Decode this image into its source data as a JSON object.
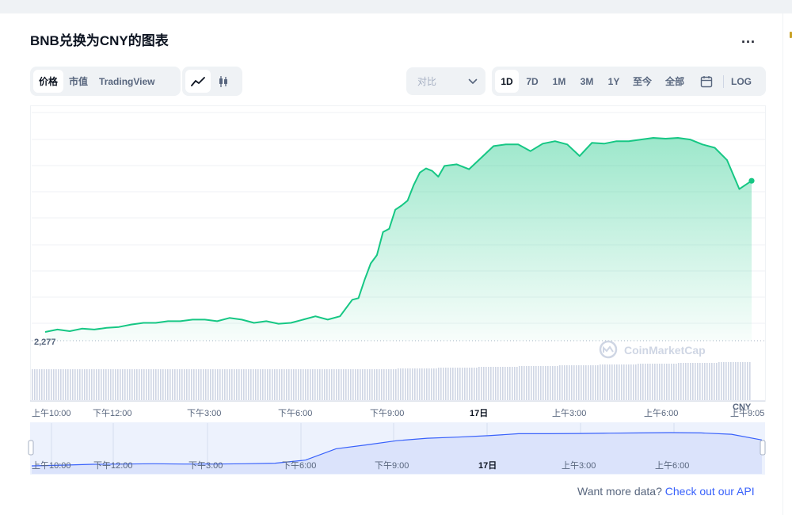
{
  "header": {
    "title": "BNB兑换为CNY的图表",
    "more_label": "..."
  },
  "toolbar": {
    "type_tabs": [
      "价格",
      "市值",
      "TradingView"
    ],
    "active_type": "价格",
    "view_icons": [
      "line-chart-icon",
      "candlestick-icon"
    ],
    "compare_placeholder": "对比",
    "ranges": [
      "1D",
      "7D",
      "1M",
      "3M",
      "1Y",
      "至今",
      "全部"
    ],
    "active_range": "1D",
    "calendar_icon": "calendar-icon",
    "log_label": "LOG"
  },
  "watermark": "CoinMarketCap",
  "footer": {
    "prefix": "Want more data?",
    "link": "Check out our API"
  },
  "colors": {
    "line": "#16c784",
    "accent": "#3861fb",
    "navigator_line": "#3861fb"
  },
  "chart_data": {
    "type": "line",
    "baseline_label": "2,277",
    "currency_label": "CNY",
    "x_tick_labels": [
      "上午10:00",
      "下午12:00",
      "下午3:00",
      "下午6:00",
      "下午9:00",
      "17日",
      "上午3:00",
      "上午6:00",
      "上午9:05"
    ],
    "navigator_tick_labels": [
      "上午10:00",
      "下午12:00",
      "下午3:00",
      "下午6:00",
      "下午9:00",
      "17日",
      "上午3:00",
      "上午6:00"
    ],
    "x_hours": [
      0,
      0.4,
      0.8,
      1.2,
      1.6,
      2.0,
      2.4,
      2.8,
      3.2,
      3.6,
      4.0,
      4.4,
      4.8,
      5.2,
      5.6,
      6.0,
      6.4,
      6.8,
      7.2,
      7.6,
      8.0,
      8.4,
      8.8,
      9.2,
      9.6,
      10.0,
      10.2,
      10.4,
      10.6,
      10.8,
      11.0,
      11.2,
      11.4,
      11.6,
      11.8,
      12.0,
      12.2,
      12.4,
      12.6,
      12.8,
      13.0,
      13.4,
      13.8,
      14.2,
      14.6,
      15.0,
      15.4,
      15.8,
      16.2,
      16.6,
      17.0,
      17.4,
      17.8,
      18.2,
      18.6,
      19.0,
      19.4,
      19.8,
      20.2,
      20.6,
      21.0,
      21.4,
      21.8,
      22.2,
      22.6,
      23.0
    ],
    "values": [
      2277,
      2280,
      2278,
      2281,
      2280,
      2282,
      2283,
      2286,
      2288,
      2288,
      2290,
      2290,
      2292,
      2292,
      2290,
      2294,
      2292,
      2288,
      2290,
      2287,
      2288,
      2292,
      2296,
      2292,
      2296,
      2316,
      2318,
      2340,
      2360,
      2370,
      2398,
      2402,
      2425,
      2430,
      2436,
      2455,
      2470,
      2475,
      2472,
      2465,
      2478,
      2480,
      2474,
      2488,
      2502,
      2504,
      2504,
      2496,
      2505,
      2508,
      2504,
      2490,
      2506,
      2505,
      2508,
      2508,
      2510,
      2512,
      2511,
      2512,
      2510,
      2504,
      2500,
      2485,
      2450,
      2460
    ],
    "navigator_values": [
      2277,
      2282,
      2288,
      2290,
      2292,
      2290,
      2290,
      2292,
      2296,
      2318,
      2398,
      2425,
      2455,
      2472,
      2480,
      2490,
      2504,
      2504,
      2506,
      2508,
      2510,
      2512,
      2510,
      2500,
      2460
    ]
  }
}
